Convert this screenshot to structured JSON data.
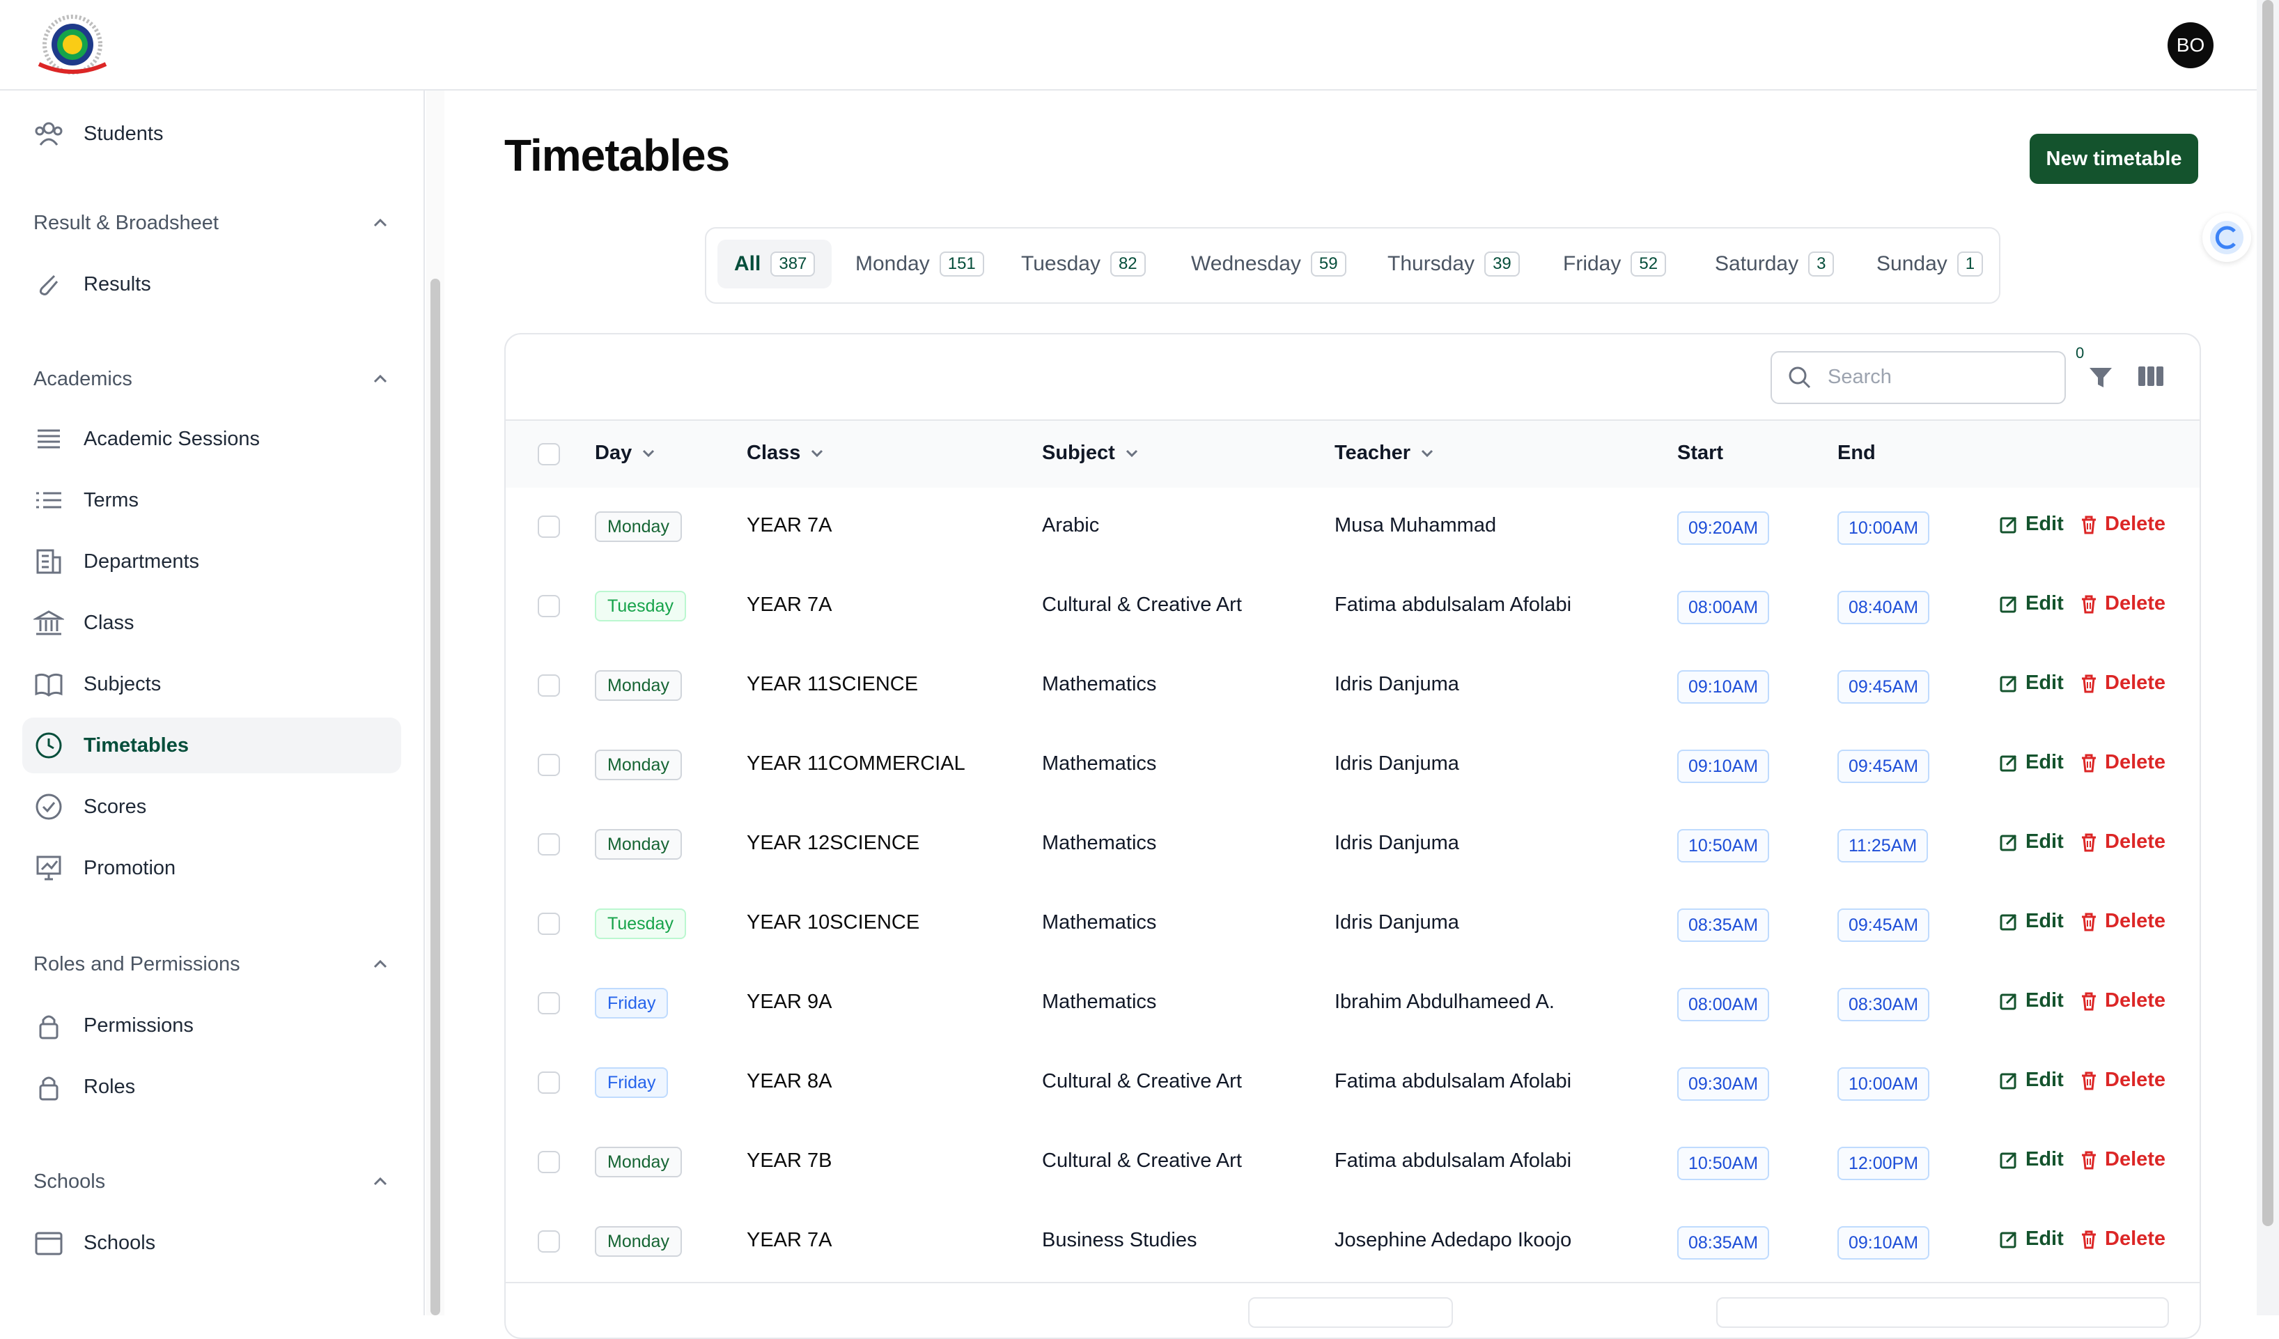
{
  "header": {
    "avatar_initials": "BO"
  },
  "sidebar": {
    "items_top": [
      {
        "label": "Students",
        "icon": "users-icon"
      }
    ],
    "groups": [
      {
        "title": "Result & Broadsheet",
        "items": [
          {
            "label": "Results",
            "icon": "paperclip-icon"
          }
        ]
      },
      {
        "title": "Academics",
        "items": [
          {
            "label": "Academic Sessions",
            "icon": "stack-icon"
          },
          {
            "label": "Terms",
            "icon": "list-icon"
          },
          {
            "label": "Departments",
            "icon": "building-icon"
          },
          {
            "label": "Class",
            "icon": "bank-icon"
          },
          {
            "label": "Subjects",
            "icon": "book-icon"
          },
          {
            "label": "Timetables",
            "icon": "clock-icon",
            "active": true
          },
          {
            "label": "Scores",
            "icon": "check-circle-icon"
          },
          {
            "label": "Promotion",
            "icon": "presentation-icon"
          }
        ]
      },
      {
        "title": "Roles and Permissions",
        "items": [
          {
            "label": "Permissions",
            "icon": "lock-icon"
          },
          {
            "label": "Roles",
            "icon": "lock-icon"
          }
        ]
      },
      {
        "title": "Schools",
        "items": [
          {
            "label": "Schools",
            "icon": "browser-icon"
          }
        ]
      }
    ]
  },
  "page": {
    "title": "Timetables",
    "new_button": "New timetable"
  },
  "tabs": [
    {
      "label": "All",
      "count": "387",
      "active": true
    },
    {
      "label": "Monday",
      "count": "151"
    },
    {
      "label": "Tuesday",
      "count": "82"
    },
    {
      "label": "Wednesday",
      "count": "59"
    },
    {
      "label": "Thursday",
      "count": "39"
    },
    {
      "label": "Friday",
      "count": "52"
    },
    {
      "label": "Saturday",
      "count": "3"
    },
    {
      "label": "Sunday",
      "count": "1"
    }
  ],
  "toolbar": {
    "search_placeholder": "Search",
    "filter_count": "0"
  },
  "table": {
    "columns": {
      "day": "Day",
      "class": "Class",
      "subject": "Subject",
      "teacher": "Teacher",
      "start": "Start",
      "end": "End"
    },
    "edit_label": "Edit",
    "delete_label": "Delete",
    "rows": [
      {
        "day": "Monday",
        "class": "YEAR 7A",
        "subject": "Arabic",
        "teacher": "Musa Muhammad",
        "start": "09:20AM",
        "end": "10:00AM"
      },
      {
        "day": "Tuesday",
        "class": "YEAR 7A",
        "subject": "Cultural & Creative Art",
        "teacher": "Fatima abdulsalam Afolabi",
        "start": "08:00AM",
        "end": "08:40AM"
      },
      {
        "day": "Monday",
        "class": "YEAR 11SCIENCE",
        "subject": "Mathematics",
        "teacher": "Idris Danjuma",
        "start": "09:10AM",
        "end": "09:45AM"
      },
      {
        "day": "Monday",
        "class": "YEAR 11COMMERCIAL",
        "subject": "Mathematics",
        "teacher": "Idris Danjuma",
        "start": "09:10AM",
        "end": "09:45AM"
      },
      {
        "day": "Monday",
        "class": "YEAR 12SCIENCE",
        "subject": "Mathematics",
        "teacher": "Idris Danjuma",
        "start": "10:50AM",
        "end": "11:25AM"
      },
      {
        "day": "Tuesday",
        "class": "YEAR 10SCIENCE",
        "subject": "Mathematics",
        "teacher": "Idris Danjuma",
        "start": "08:35AM",
        "end": "09:45AM"
      },
      {
        "day": "Friday",
        "class": "YEAR 9A",
        "subject": "Mathematics",
        "teacher": "Ibrahim Abdulhameed A.",
        "start": "08:00AM",
        "end": "08:30AM"
      },
      {
        "day": "Friday",
        "class": "YEAR 8A",
        "subject": "Cultural & Creative Art",
        "teacher": "Fatima abdulsalam Afolabi",
        "start": "09:30AM",
        "end": "10:00AM"
      },
      {
        "day": "Monday",
        "class": "YEAR 7B",
        "subject": "Cultural & Creative Art",
        "teacher": "Fatima abdulsalam Afolabi",
        "start": "10:50AM",
        "end": "12:00PM"
      },
      {
        "day": "Monday",
        "class": "YEAR 7A",
        "subject": "Business Studies",
        "teacher": "Josephine Adedapo Ikoojo",
        "start": "08:35AM",
        "end": "09:10AM"
      }
    ]
  },
  "colors": {
    "brand": "#14532d",
    "danger": "#dc2626",
    "time_blue": "#1d4ed8"
  }
}
